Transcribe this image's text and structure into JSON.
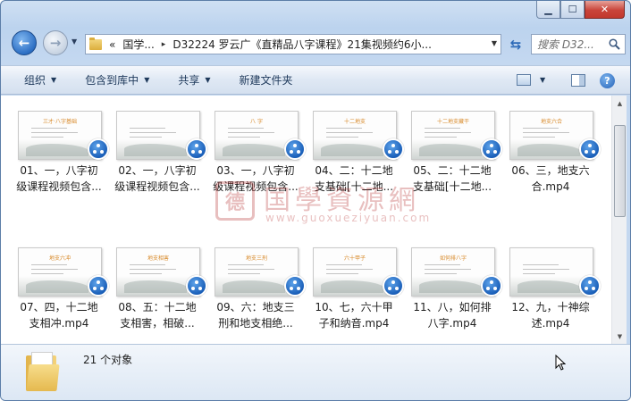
{
  "window": {
    "caption_buttons": {
      "minimize": "▁",
      "maximize": "☐",
      "close": "✕"
    }
  },
  "nav": {
    "back_icon": "←",
    "forward_icon": "→",
    "recent_dropdown": "▼"
  },
  "address": {
    "prefix": "«",
    "crumbs": [
      "国学...",
      "D32224 罗云广《直精品八字课程》21集视频约6小..."
    ],
    "separator": "▸",
    "dropdown": "▼"
  },
  "refresh_icon": "⇆",
  "search": {
    "placeholder": "搜索 D32..."
  },
  "toolbar": {
    "items": [
      {
        "label": "组织",
        "has_menu": true
      },
      {
        "label": "包含到库中",
        "has_menu": true
      },
      {
        "label": "共享",
        "has_menu": true
      },
      {
        "label": "新建文件夹",
        "has_menu": false
      }
    ],
    "caret": "▼",
    "help": "?"
  },
  "files": [
    {
      "line1": "01、一，八字初",
      "line2": "级课程视频包含...",
      "thumb_title": "三才·八字基础"
    },
    {
      "line1": "02、一，八字初",
      "line2": "级课程视频包含...",
      "thumb_title": ""
    },
    {
      "line1": "03、一，八字初",
      "line2": "级课程视频包含...",
      "thumb_title": "八 字"
    },
    {
      "line1": "04、二：十二地",
      "line2": "支基础[十二地...",
      "thumb_title": "十二地支"
    },
    {
      "line1": "05、二：十二地",
      "line2": "支基础[十二地...",
      "thumb_title": "十二地支藏干"
    },
    {
      "line1": "06、三，地支六",
      "line2": "合.mp4",
      "thumb_title": "地支六合"
    },
    {
      "line1": "07、四，十二地",
      "line2": "支相冲.mp4",
      "thumb_title": "地支六冲"
    },
    {
      "line1": "08、五：十二地",
      "line2": "支相害，相破...",
      "thumb_title": "地支相害"
    },
    {
      "line1": "09、六：地支三",
      "line2": "刑和地支相绝...",
      "thumb_title": "地支三刑"
    },
    {
      "line1": "10、七，六十甲",
      "line2": "子和纳音.mp4",
      "thumb_title": "六十甲子"
    },
    {
      "line1": "11、八，如何排",
      "line2": "八字.mp4",
      "thumb_title": "如何排八字"
    },
    {
      "line1": "12、九，十神综",
      "line2": "述.mp4",
      "thumb_title": ""
    }
  ],
  "watermark": {
    "seal": "德",
    "text": "国學資源網",
    "url": "www.guoxueziyuan.com"
  },
  "details": {
    "count_text": "21 个对象"
  }
}
